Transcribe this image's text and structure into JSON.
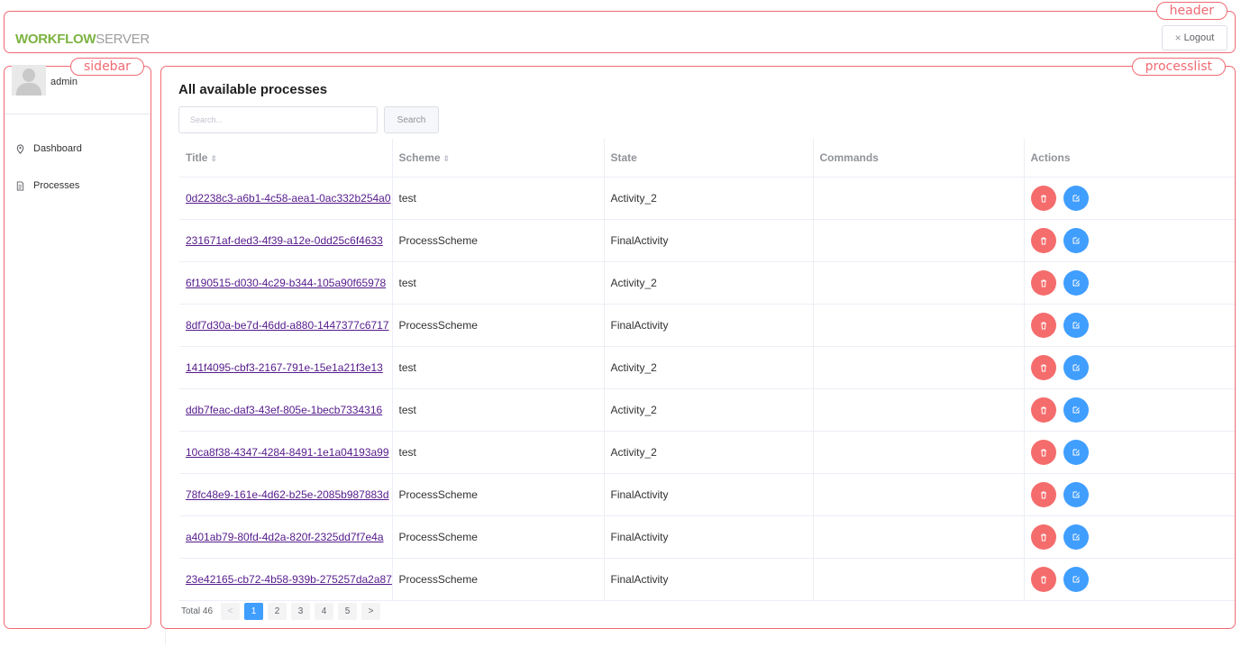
{
  "header": {
    "logo_part1": "WORKFLOW",
    "logo_part2": "SERVER",
    "logout_label": "Logout",
    "annotation": "header"
  },
  "sidebar": {
    "annotation": "sidebar",
    "username": "admin",
    "items": [
      {
        "label": "Dashboard",
        "icon": "location-pin-icon"
      },
      {
        "label": "Processes",
        "icon": "document-icon"
      }
    ]
  },
  "processlist": {
    "annotation": "processlist",
    "title": "All available processes",
    "search_placeholder": "Search...",
    "search_button": "Search",
    "columns": [
      "Title",
      "Scheme",
      "State",
      "Commands",
      "Actions"
    ],
    "rows": [
      {
        "title": "0d2238c3-a6b1-4c58-aea1-0ac332b254a0",
        "scheme": "test",
        "state": "Activity_2",
        "commands": ""
      },
      {
        "title": "231671af-ded3-4f39-a12e-0dd25c6f4633",
        "scheme": "ProcessScheme",
        "state": "FinalActivity",
        "commands": ""
      },
      {
        "title": "6f190515-d030-4c29-b344-105a90f65978",
        "scheme": "test",
        "state": "Activity_2",
        "commands": ""
      },
      {
        "title": "8df7d30a-be7d-46dd-a880-1447377c6717",
        "scheme": "ProcessScheme",
        "state": "FinalActivity",
        "commands": ""
      },
      {
        "title": "141f4095-cbf3-2167-791e-15e1a21f3e13",
        "scheme": "test",
        "state": "Activity_2",
        "commands": ""
      },
      {
        "title": "ddb7feac-daf3-43ef-805e-1becb7334316",
        "scheme": "test",
        "state": "Activity_2",
        "commands": ""
      },
      {
        "title": "10ca8f38-4347-4284-8491-1e1a04193a99",
        "scheme": "test",
        "state": "Activity_2",
        "commands": ""
      },
      {
        "title": "78fc48e9-161e-4d62-b25e-2085b987883d",
        "scheme": "ProcessScheme",
        "state": "FinalActivity",
        "commands": ""
      },
      {
        "title": "a401ab79-80fd-4d2a-820f-2325dd7f7e4a",
        "scheme": "ProcessScheme",
        "state": "FinalActivity",
        "commands": ""
      },
      {
        "title": "23e42165-cb72-4b58-939b-275257da2a87",
        "scheme": "ProcessScheme",
        "state": "FinalActivity",
        "commands": ""
      }
    ],
    "pagination": {
      "total": "Total 46",
      "prev": "<",
      "next": ">",
      "pages": [
        "1",
        "2",
        "3",
        "4",
        "5"
      ],
      "current": "1"
    }
  },
  "colors": {
    "annotation": "#f06a73",
    "logo_green": "#7cb342",
    "delete": "#f56c6c",
    "edit": "#409eff"
  }
}
